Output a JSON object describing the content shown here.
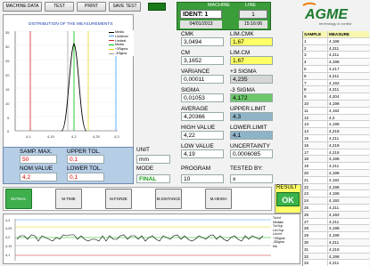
{
  "toolbar": {
    "machine_data": "MACHINE DATA",
    "test": "TEST",
    "print": "PRINT",
    "save_test": "SAVE TEST"
  },
  "header": {
    "machine_label": "MACHINE",
    "ident_text": "IDENT: 1",
    "line_label": "LINE",
    "line_value": "1",
    "date": "04/01/2013",
    "time": "15:16:06"
  },
  "logo": {
    "name": "AGME",
    "tagline": "technology & control"
  },
  "histogram": {
    "title": "DISTRIBUTION OF THE MEASUREMENTS",
    "legend": [
      "Media",
      "Limitenor",
      "Limitesl",
      "Media",
      "+3Sigma",
      "-3Sigma"
    ],
    "colors": {
      "curve": "#000000",
      "mean": "#00c000",
      "upper": "#3b9bff",
      "lower": "#d02020",
      "plus3": "#e0d000",
      "minus3": "#9a9a9a"
    }
  },
  "stats": {
    "cmk_label": "CMK",
    "cmk_value": "3,0494",
    "lim_cmk_label": "LIM.CMK",
    "lim_cmk_value": "1,67",
    "cm_label": "CM",
    "cm_value": "3,1652",
    "lim_cm_label": "LIM.CM",
    "lim_cm_value": "1,67",
    "variance_label": "VARIANCE",
    "variance_value": "0,00011",
    "plus3_label": "+3 SIGMA",
    "plus3_value": "4,235",
    "sigma_label": "SIGMA",
    "sigma_value": "0,01053",
    "minus3_label": "-3 SIGMA",
    "minus3_value": "4,172",
    "average_label": "AVERAGE",
    "average_value": "4,20366",
    "upper_limit_label": "UPPER.LIMIT",
    "upper_limit_value": "4,3",
    "high_label": "HIGH VALUE",
    "high_value": "4,22",
    "lower_limit_label": "LOWER.LIMIT",
    "lower_limit_value": "4,1",
    "low_label": "LOW VALUE",
    "low_value": "4,19",
    "uncertainty_label": "UNCERTAINTY",
    "uncertainty_value": "0,0006085"
  },
  "config": {
    "samp_max_label": "SAMP. MAX.",
    "samp_max_value": "50",
    "upper_tol_label": "UPPER TOL.",
    "upper_tol_value": "0,1",
    "nom_value_label": "NOM.VALUE",
    "nom_value_value": "4,2",
    "lower_tol_label": "LOWER TOL.",
    "lower_tol_value": "0,1",
    "unit_label": "UNIT",
    "unit_value": "mm",
    "mode_label": "MODE",
    "mode_value": "FINAL",
    "program_label": "PROGRAM",
    "program_value": "10",
    "tested_by_label": "TESTED BY:",
    "tested_by_value": "x",
    "result_label": "RESULT",
    "result_value": "OK"
  },
  "tests": [
    "M.FINAL",
    "M.TIME",
    "M.FORZE",
    "M.DISTANCE",
    "M.HEIGH"
  ],
  "run_chart": {
    "y_ticks": [
      "4,3",
      "4,25",
      "4,2",
      "4,15",
      "4,1"
    ],
    "legend": [
      "Tol.Inf",
      "Mediale",
      "Tol.Sup",
      "Lim.Sup",
      "Lim.Inf",
      "+3Sigma",
      "-3Sigma",
      "Ma"
    ]
  },
  "table": {
    "col_sample": "SAMPLE",
    "col_measure": "MEASURE",
    "rows": [
      [
        "1",
        "4,198"
      ],
      [
        "2",
        "4,211"
      ],
      [
        "3",
        "4,211"
      ],
      [
        "4",
        "4,198"
      ],
      [
        "5",
        "4,217"
      ],
      [
        "6",
        "4,211"
      ],
      [
        "7",
        "4,192"
      ],
      [
        "8",
        "4,211"
      ],
      [
        "9",
        "4,204"
      ],
      [
        "10",
        "4,198"
      ],
      [
        "11",
        "4,192"
      ],
      [
        "12",
        "4,2"
      ],
      [
        "13",
        "4,198"
      ],
      [
        "14",
        "4,218"
      ],
      [
        "15",
        "4,211"
      ],
      [
        "16",
        "4,218"
      ],
      [
        "17",
        "4,218"
      ],
      [
        "18",
        "4,198"
      ],
      [
        "19",
        "4,211"
      ],
      [
        "20",
        "4,198"
      ],
      [
        "21",
        "4,192"
      ],
      [
        "22",
        "4,198"
      ],
      [
        "23",
        "4,198"
      ],
      [
        "24",
        "4,192"
      ],
      [
        "25",
        "4,211"
      ],
      [
        "26",
        "4,192"
      ],
      [
        "27",
        "4,211"
      ],
      [
        "28",
        "4,198"
      ],
      [
        "29",
        "4,198"
      ],
      [
        "30",
        "4,211"
      ],
      [
        "31",
        "4,218"
      ],
      [
        "32",
        "4,198"
      ],
      [
        "33",
        "4,211"
      ],
      [
        "34",
        "4,212"
      ]
    ]
  }
}
